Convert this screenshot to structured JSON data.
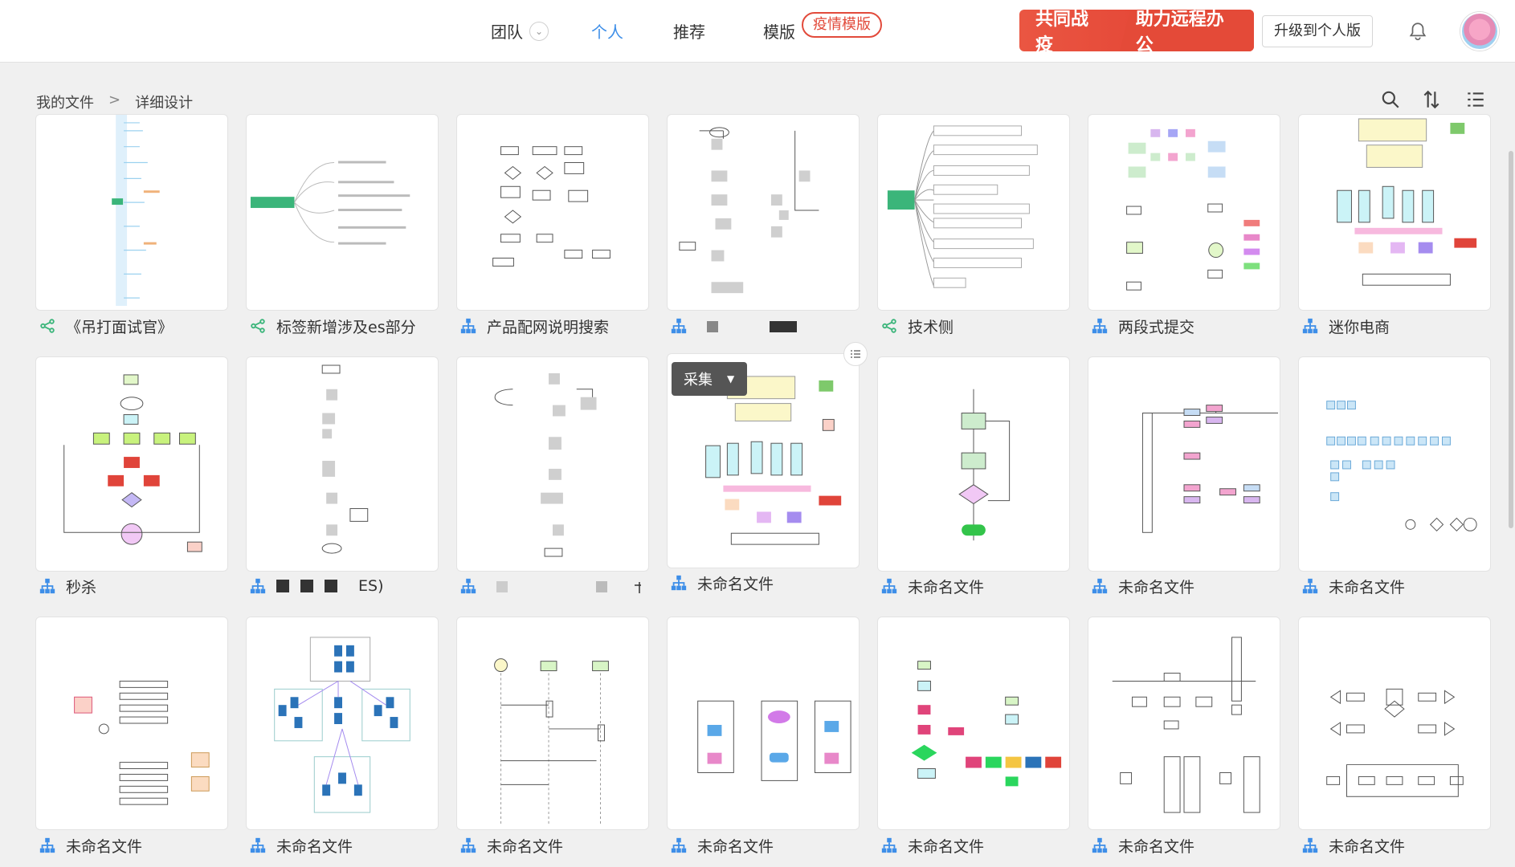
{
  "header": {
    "nav": [
      {
        "label": "团队"
      },
      {
        "label": "个人"
      },
      {
        "label": "推荐"
      },
      {
        "label": "模版"
      }
    ],
    "template_tag": "疫情模版",
    "promo": {
      "left": "共同战疫",
      "right": "助力远程办公"
    },
    "upgrade_label": "升级到个人版"
  },
  "breadcrumb": {
    "root": "我的文件",
    "sep": ">",
    "current": "详细设计"
  },
  "overlay": {
    "collect_label": "采集"
  },
  "files": [
    {
      "name": "《吊打面试官》",
      "icon": "mindmap-icon"
    },
    {
      "name": "标签新增涉及es部分",
      "icon": "mindmap-icon"
    },
    {
      "name": "产品配网说明搜索",
      "icon": "flowchart-icon"
    },
    {
      "name": "",
      "icon": "flowchart-icon"
    },
    {
      "name": "技术侧",
      "icon": "mindmap-icon"
    },
    {
      "name": "两段式提交",
      "icon": "flowchart-icon"
    },
    {
      "name": "迷你电商",
      "icon": "flowchart-icon"
    },
    {
      "name": "秒杀",
      "icon": "flowchart-icon"
    },
    {
      "name": "ES)",
      "icon": "flowchart-icon"
    },
    {
      "name": "",
      "icon": "flowchart-icon"
    },
    {
      "name": "未命名文件",
      "icon": "flowchart-icon"
    },
    {
      "name": "未命名文件",
      "icon": "flowchart-icon"
    },
    {
      "name": "未命名文件",
      "icon": "flowchart-icon"
    },
    {
      "name": "未命名文件",
      "icon": "flowchart-icon"
    },
    {
      "name": "未命名文件",
      "icon": "flowchart-icon"
    },
    {
      "name": "未命名文件",
      "icon": "flowchart-icon"
    },
    {
      "name": "未命名文件",
      "icon": "flowchart-icon"
    },
    {
      "name": "未命名文件",
      "icon": "flowchart-icon"
    },
    {
      "name": "未命名文件",
      "icon": "flowchart-icon"
    },
    {
      "name": "未命名文件",
      "icon": "flowchart-icon"
    },
    {
      "name": "未命名文件",
      "icon": "flowchart-icon"
    }
  ],
  "colors": {
    "accent": "#3d8ee8",
    "promo_red": "#e24a3b",
    "mindmap_green": "#3bb57a"
  }
}
